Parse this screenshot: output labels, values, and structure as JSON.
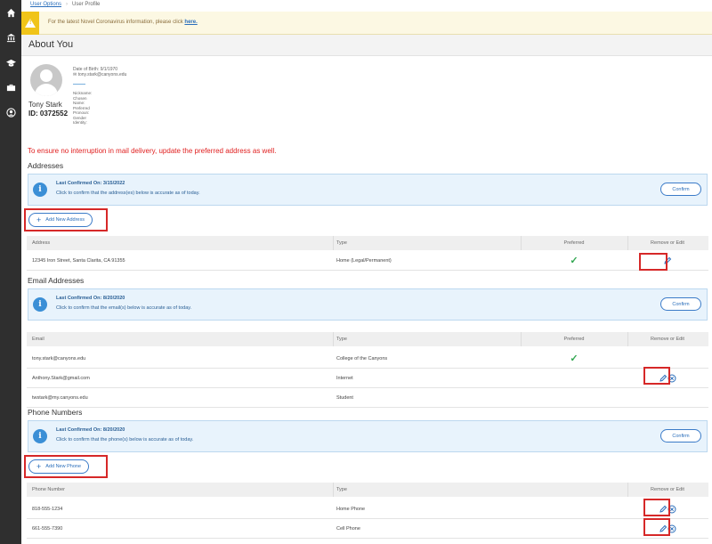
{
  "breadcrumb": {
    "parent": "User Options",
    "current": "User Profile"
  },
  "covid": {
    "text": "For the latest Novel Coronavirus information, please click",
    "link": "here."
  },
  "page_title": "About You",
  "profile": {
    "dob": "Date of Birth: 9/1/1970",
    "email": "tony.stark@canyons.edu",
    "name": "Tony Stark",
    "id": "ID: 0372552",
    "fields": [
      "Nickname:",
      "Chosen",
      "Name:",
      "Preferred",
      "Pronoun:",
      "Gender",
      "Identity:"
    ]
  },
  "notice": "To ensure no interruption in mail delivery, update the preferred address as well.",
  "addresses": {
    "title": "Addresses",
    "last_confirmed": "Last Confirmed On: 3/15/2022",
    "confirm_text": "Click to confirm that the address(es) below is accurate as of today.",
    "confirm_btn": "Confirm",
    "add_btn": "Add New Address",
    "headers": [
      "Address",
      "Type",
      "Preferred",
      "Remove or Edit"
    ],
    "rows": [
      {
        "address": "12345 Iron Street, Santa Clarita, CA 91355",
        "type": "Home (Legal/Permanent)"
      }
    ]
  },
  "emails": {
    "title": "Email Addresses",
    "last_confirmed": "Last Confirmed On: 8/20/2020",
    "confirm_text": "Click to confirm that the email(s) below is accurate as of today.",
    "confirm_btn": "Confirm",
    "headers": [
      "Email",
      "Type",
      "Preferred",
      "Remove or Edit"
    ],
    "rows": [
      {
        "email": "tony.stark@canyons.edu",
        "type": "College of the Canyons"
      },
      {
        "email": "Anthony.Stark@gmail.com",
        "type": "Internet"
      },
      {
        "email": "twstark@my.canyons.edu",
        "type": "Student"
      }
    ]
  },
  "phones": {
    "title": "Phone Numbers",
    "last_confirmed": "Last Confirmed On: 8/20/2020",
    "confirm_text": "Click to confirm that the phone(s) below is accurate as of today.",
    "confirm_btn": "Confirm",
    "add_btn": "Add New Phone",
    "headers": [
      "Phone Number",
      "Type",
      "Remove or Edit"
    ],
    "rows": [
      {
        "phone": "818-555-1234",
        "type": "Home Phone"
      },
      {
        "phone": "661-555-7390",
        "type": "Cell Phone"
      }
    ]
  },
  "colors": {
    "accent": "#2a6ebb",
    "sidebar": "#2f2f2f",
    "alert": "#d62828",
    "check": "#34a853"
  },
  "icons": [
    "home-icon",
    "bank-icon",
    "graduation-cap-icon",
    "briefcase-icon",
    "user-circle-icon",
    "warning-icon",
    "info-icon",
    "plus-icon",
    "check-icon",
    "pencil-icon",
    "remove-circle-icon",
    "envelope-icon"
  ]
}
